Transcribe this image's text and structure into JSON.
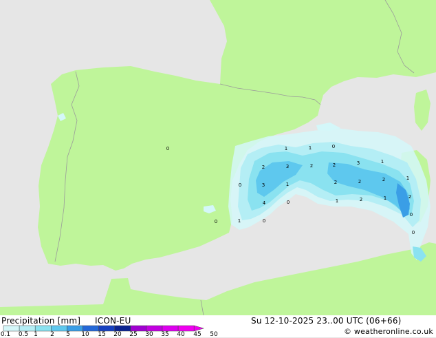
{
  "colors": {
    "sea": "#e6e6e6",
    "land": "#bff59a",
    "border": "#9a9a9a",
    "precip": [
      "#d4f7f9",
      "#b4eef5",
      "#8ae2f0",
      "#5ec8ee",
      "#3a9ee6",
      "#2468d8",
      "#1640c0",
      "#0a2290",
      "#a000d0",
      "#c200e0",
      "#dd00ee",
      "#f000f0"
    ]
  },
  "footer": {
    "title": "Precipitation [mm]",
    "model": "ICON-EU",
    "datetime": "Su 12-10-2025 23..00 UTC (06+66)",
    "copyright": "© weatheronline.co.uk"
  },
  "legend": {
    "ticks": [
      "0.1",
      "0.5",
      "1",
      "2",
      "5",
      "10",
      "15",
      "20",
      "25",
      "30",
      "35",
      "40",
      "45",
      "50"
    ]
  },
  "precip_values": [
    "1",
    "1",
    "0",
    "2",
    "3",
    "2",
    "2",
    "3",
    "1",
    "0",
    "3",
    "1",
    "2",
    "2",
    "2",
    "1",
    "4",
    "0",
    "1",
    "2",
    "1",
    "2",
    "0",
    "1",
    "0",
    "0",
    "0",
    "0"
  ]
}
